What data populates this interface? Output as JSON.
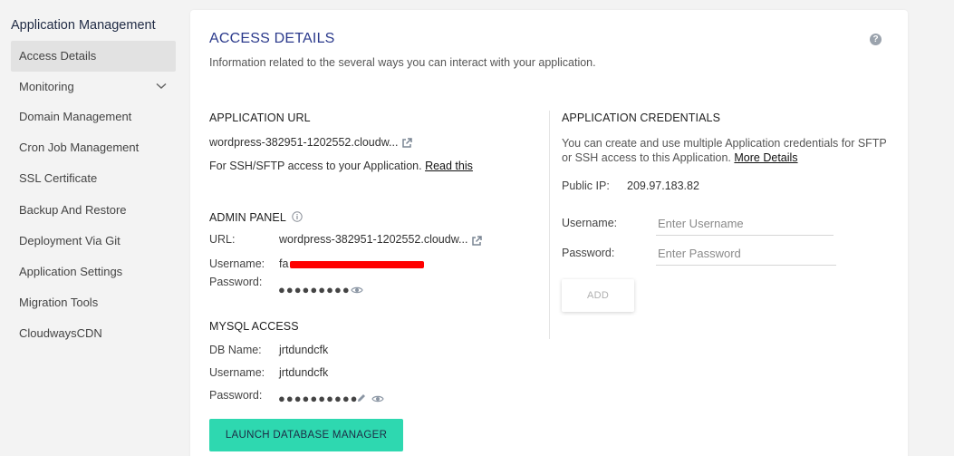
{
  "sidebar": {
    "title": "Application Management",
    "items": [
      {
        "label": "Access Details"
      },
      {
        "label": "Monitoring"
      },
      {
        "label": "Domain Management"
      },
      {
        "label": "Cron Job Management"
      },
      {
        "label": "SSL Certificate"
      },
      {
        "label": "Backup And Restore"
      },
      {
        "label": "Deployment Via Git"
      },
      {
        "label": "Application Settings"
      },
      {
        "label": "Migration Tools"
      },
      {
        "label": "CloudwaysCDN"
      }
    ]
  },
  "main": {
    "title": "ACCESS DETAILS",
    "subtitle": "Information related to the several ways you can interact with your application.",
    "help": "?",
    "app_url": {
      "heading": "APPLICATION URL",
      "url": "wordpress-382951-1202552.cloudw...",
      "ssh_text": "For SSH/SFTP access to your Application.",
      "ssh_link": "Read this"
    },
    "admin_panel": {
      "heading": "ADMIN PANEL",
      "url_label": "URL:",
      "url_value": "wordpress-382951-1202552.cloudw...",
      "username_label": "Username:",
      "username_value": "fa",
      "password_label": "Password:",
      "password_value": "●●●●●●●●●"
    },
    "mysql": {
      "heading": "MYSQL ACCESS",
      "dbname_label": "DB Name:",
      "dbname_value": "jrtdundcfk",
      "username_label": "Username:",
      "username_value": "jrtdundcfk",
      "password_label": "Password:",
      "password_value": "●●●●●●●●●●",
      "launch_button": "LAUNCH DATABASE MANAGER"
    },
    "credentials": {
      "heading": "APPLICATION CREDENTIALS",
      "desc_line1": "You can create and use multiple Application credentials for SFTP",
      "desc_line2": "or SSH access to this Application.",
      "more_link": "More Details",
      "ip_label": "Public IP:",
      "ip_value": "209.97.183.82",
      "username_label": "Username:",
      "username_placeholder": "Enter Username",
      "password_label": "Password:",
      "password_placeholder": "Enter Password",
      "add_button": "ADD"
    }
  },
  "colors": {
    "accent": "#2ed8b0",
    "title": "#2b3a8c",
    "redaction": "#ff0000"
  }
}
